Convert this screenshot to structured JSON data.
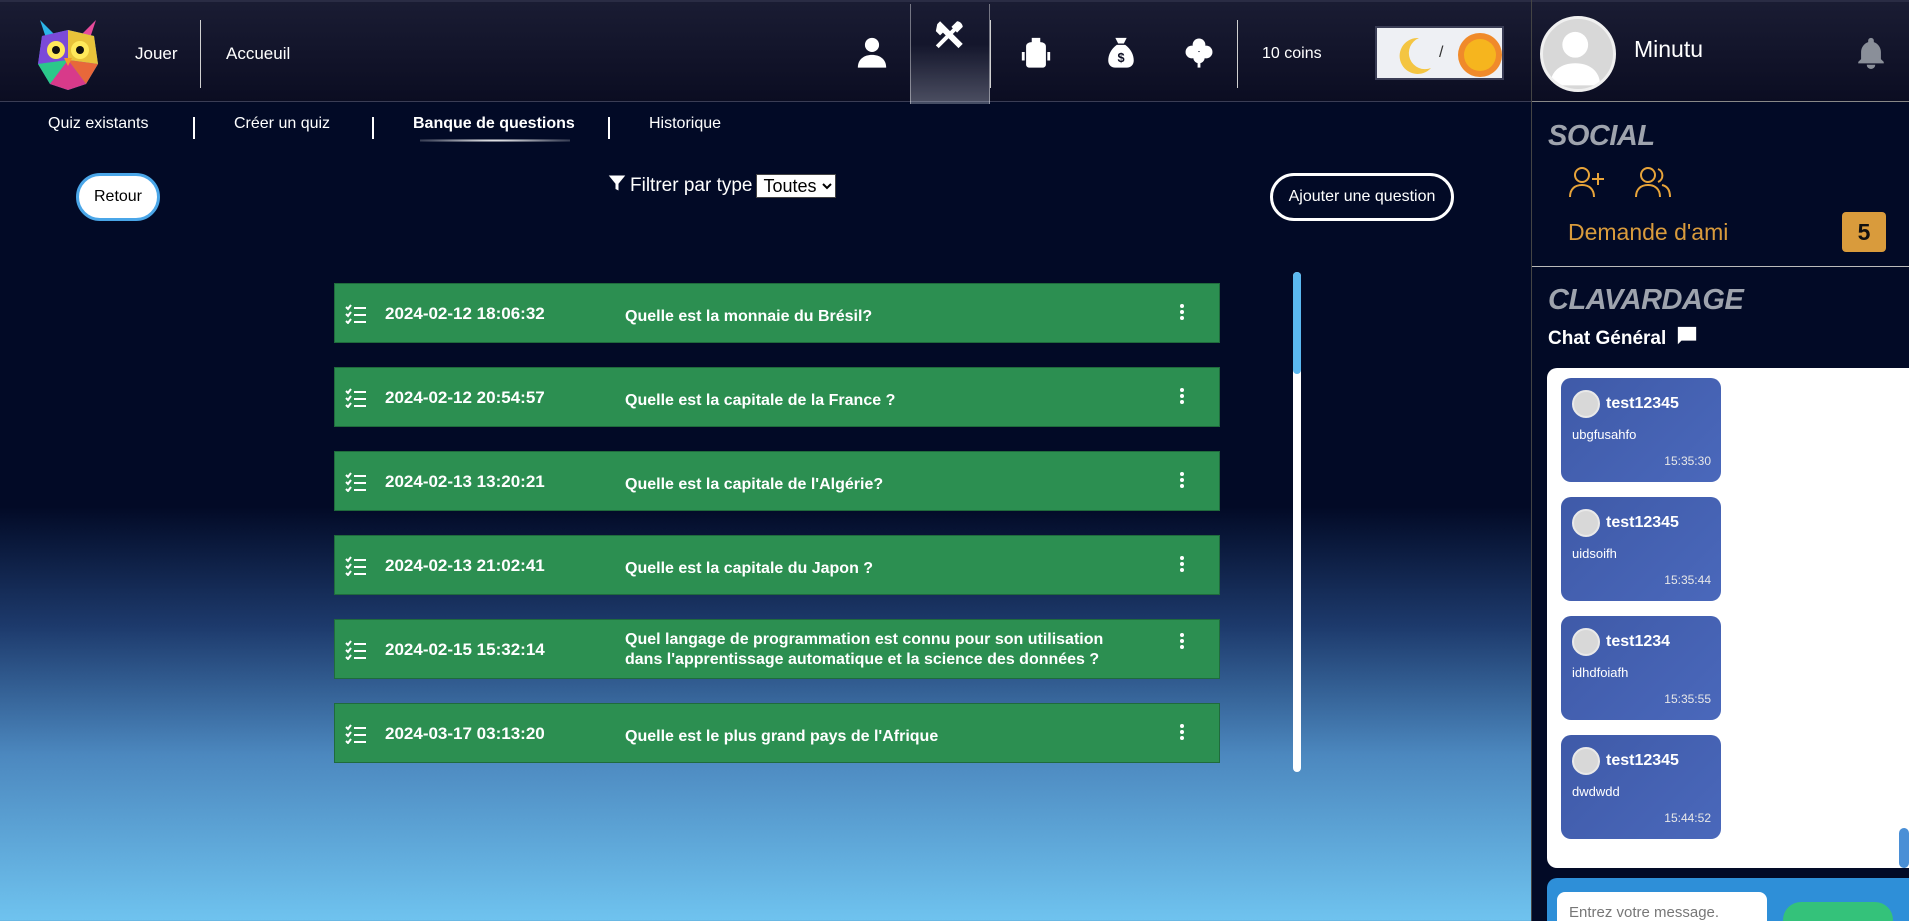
{
  "topbar": {
    "nav": {
      "play": "Jouer",
      "home": "Accueuil"
    },
    "icons": [
      "profile-icon",
      "tools-icon",
      "backpack-icon",
      "money-bag-icon",
      "clover-icon"
    ],
    "coins": "10 coins",
    "theme_separator": "/"
  },
  "subnav": {
    "items": [
      "Quiz existants",
      "Créer un quiz",
      "Banque de questions",
      "Historique"
    ],
    "active_index": 2
  },
  "controls": {
    "back_label": "Retour",
    "filter_label": "Filtrer par type",
    "filter_value": "Toutes",
    "add_label": "Ajouter une question"
  },
  "questions": [
    {
      "date": "2024-02-12 18:06:32",
      "text": "Quelle est la monnaie du Brésil?"
    },
    {
      "date": "2024-02-12 20:54:57",
      "text": "Quelle est la capitale de la France ?"
    },
    {
      "date": "2024-02-13 13:20:21",
      "text": "Quelle est la capitale de l'Algérie?"
    },
    {
      "date": "2024-02-13 21:02:41",
      "text": "Quelle est la capitale du Japon ?"
    },
    {
      "date": "2024-02-15 15:32:14",
      "text": "Quel langage de programmation est connu pour son utilisation dans l'apprentissage automatique et la science des données ?"
    },
    {
      "date": "2024-03-17 03:13:20",
      "text": "Quelle est le plus grand pays de l'Afrique"
    }
  ],
  "user": {
    "name": "Minutu"
  },
  "social": {
    "title": "SOCIAL",
    "friend_request_label": "Demande d'ami",
    "friend_request_count": "5",
    "accent": "#d99b3c"
  },
  "chat": {
    "title": "CLAVARDAGE",
    "channel": "Chat Général",
    "messages": [
      {
        "user": "test12345",
        "text": "ubgfusahfo",
        "time": "15:35:30"
      },
      {
        "user": "test12345",
        "text": "uidsoifh",
        "time": "15:35:44"
      },
      {
        "user": "test1234",
        "text": "idhdfoiafh",
        "time": "15:35:55"
      },
      {
        "user": "test12345",
        "text": "dwdwdd",
        "time": "15:44:52"
      }
    ],
    "input_placeholder": "Entrez votre message."
  },
  "colors": {
    "question_row": "#2c8f51",
    "message_bubble": "#4a68bb",
    "retour_border": "#4aa6e8"
  }
}
